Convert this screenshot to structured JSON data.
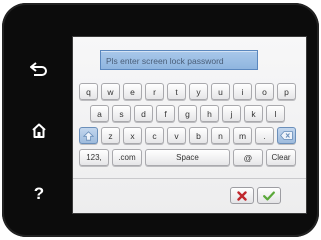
{
  "input": {
    "placeholder": "Pls enter screen lock password"
  },
  "keyboard": {
    "row1": [
      "q",
      "w",
      "e",
      "r",
      "t",
      "y",
      "u",
      "i",
      "o",
      "p"
    ],
    "row2": [
      "a",
      "s",
      "d",
      "f",
      "g",
      "h",
      "j",
      "k",
      "l"
    ],
    "row3": [
      "z",
      "x",
      "c",
      "v",
      "b",
      "n",
      "m",
      "."
    ],
    "row4": {
      "mode": "123,",
      "com": ".com",
      "space": "Space",
      "at": "@",
      "clear": "Clear"
    }
  },
  "nav": {
    "icons": [
      "back-icon",
      "home-icon",
      "help-icon"
    ],
    "help_glyph": "?"
  },
  "colors": {
    "accent": "#9ebbdd",
    "cancel": "#c0272d",
    "ok": "#5aa83a"
  }
}
